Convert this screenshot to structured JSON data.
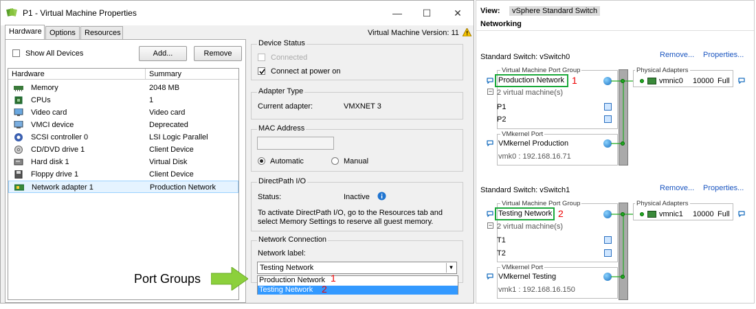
{
  "window": {
    "title": "P1 - Virtual Machine Properties",
    "tabs": [
      "Hardware",
      "Options",
      "Resources"
    ],
    "vm_version": "Virtual Machine Version: 11",
    "controls": {
      "minimize": "—",
      "maximize": "☐",
      "close": "✕"
    }
  },
  "hardware": {
    "show_all_label": "Show All Devices",
    "add_label": "Add...",
    "remove_label": "Remove",
    "col_hardware": "Hardware",
    "col_summary": "Summary",
    "rows": [
      {
        "name": "Memory",
        "summary": "2048 MB",
        "icon": "memory-icon"
      },
      {
        "name": "CPUs",
        "summary": "1",
        "icon": "cpu-icon"
      },
      {
        "name": "Video card",
        "summary": "Video card",
        "icon": "monitor-icon"
      },
      {
        "name": "VMCI device",
        "summary": "Deprecated",
        "icon": "vmci-icon"
      },
      {
        "name": "SCSI controller 0",
        "summary": "LSI Logic Parallel",
        "icon": "scsi-icon"
      },
      {
        "name": "CD/DVD drive 1",
        "summary": "Client Device",
        "icon": "cd-icon"
      },
      {
        "name": "Hard disk 1",
        "summary": "Virtual Disk",
        "icon": "disk-icon"
      },
      {
        "name": "Floppy drive 1",
        "summary": "Client Device",
        "icon": "floppy-icon"
      },
      {
        "name": "Network adapter 1",
        "summary": "Production Network",
        "icon": "network-adapter-icon"
      }
    ]
  },
  "device_status": {
    "title": "Device Status",
    "connected": "Connected",
    "connect_power_on": "Connect at power on"
  },
  "adapter_type": {
    "title": "Adapter Type",
    "label": "Current adapter:",
    "value": "VMXNET 3"
  },
  "mac": {
    "title": "MAC Address",
    "automatic": "Automatic",
    "manual": "Manual"
  },
  "directpath": {
    "title": "DirectPath I/O",
    "status_label": "Status:",
    "status_value": "Inactive",
    "note_line1": "To activate DirectPath I/O, go to the Resources tab and",
    "note_line2": "select Memory Settings to reserve all guest memory."
  },
  "netconn": {
    "title": "Network Connection",
    "label": "Network label:",
    "selected": "Testing Network",
    "options": [
      "Production Network",
      "Testing Network"
    ],
    "marks": [
      "1",
      "2"
    ]
  },
  "annotation": {
    "port_groups": "Port Groups",
    "arrow_color": "#88cc33"
  },
  "right": {
    "view_label": "View:",
    "view_value": "vSphere Standard Switch",
    "networking": "Networking",
    "switches": [
      {
        "title": "Standard Switch: vSwitch0",
        "remove": "Remove...",
        "properties": "Properties...",
        "vmpg_title": "Virtual Machine Port Group",
        "pg_name": "Production Network",
        "mark": "1",
        "vm_count": "2 virtual machine(s)",
        "vms": [
          "P1",
          "P2"
        ],
        "vmk_title": "VMkernel Port",
        "vmk_name": "VMkernel Production",
        "vmk_ip": "vmk0 : 192.168.16.71",
        "pa_title": "Physical Adapters",
        "nic": "vmnic0",
        "speed": "10000",
        "duplex": "Full"
      },
      {
        "title": "Standard Switch: vSwitch1",
        "remove": "Remove...",
        "properties": "Properties...",
        "vmpg_title": "Virtual Machine Port Group",
        "pg_name": "Testing Network",
        "mark": "2",
        "vm_count": "2 virtual machine(s)",
        "vms": [
          "T1",
          "T2"
        ],
        "vmk_title": "VMkernel Port",
        "vmk_name": "VMkernel Testing",
        "vmk_ip": "vmk1 : 192.168.16.150",
        "pa_title": "Physical Adapters",
        "nic": "vmnic1",
        "speed": "10000",
        "duplex": "Full"
      }
    ]
  },
  "colors": {
    "highlight_green": "#1aa83a",
    "mark_red": "#e00000",
    "selection_blue": "#3399ff"
  }
}
